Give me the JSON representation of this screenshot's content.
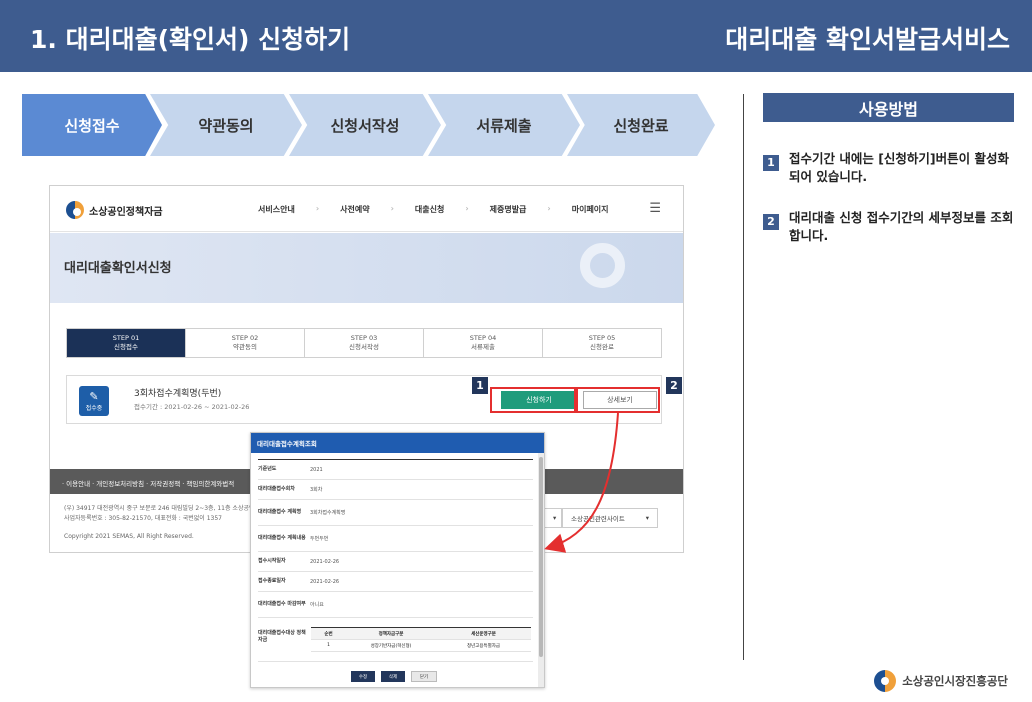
{
  "header": {
    "title": "1. 대리대출(확인서) 신청하기",
    "service": "대리대출 확인서발급서비스"
  },
  "process_steps": [
    {
      "label": "신청접수",
      "active": true
    },
    {
      "label": "약관동의",
      "active": false
    },
    {
      "label": "신청서작성",
      "active": false
    },
    {
      "label": "서류제출",
      "active": false
    },
    {
      "label": "신청완료",
      "active": false
    }
  ],
  "howto": {
    "title": "사용방법",
    "items": [
      {
        "num": "1",
        "text": "접수기간 내에는 [신청하기]버튼이 활성화 되어 있습니다."
      },
      {
        "num": "2",
        "text": "대리대출 신청 접수기간의 세부정보를 조회합니다."
      }
    ]
  },
  "footer_logo": {
    "text": "소상공인시장진흥공단"
  },
  "screenshot": {
    "logo_text": "소상공인정책자금",
    "menu": [
      "서비스안내",
      "사전예약",
      "대출신청",
      "제증명발급",
      "마이페이지"
    ],
    "banner_title": "대리대출확인서신청",
    "steps": [
      {
        "step": "STEP 01",
        "label": "신청접수"
      },
      {
        "step": "STEP 02",
        "label": "약관동의"
      },
      {
        "step": "STEP 03",
        "label": "신청서작성"
      },
      {
        "step": "STEP 04",
        "label": "서류제출"
      },
      {
        "step": "STEP 05",
        "label": "신청완료"
      }
    ],
    "card": {
      "icon_label": "접수중",
      "title": "3회차접수계획명(두번)",
      "period": "접수기간 : 2021-02-26 ~ 2021-02-26",
      "apply_label": "신청하기",
      "detail_label": "상세보기"
    },
    "markers": [
      "1",
      "2"
    ],
    "footer_links": "· 이용안내  · 개인정보처리방침  · 저작권정책  · 책임의한계와법적",
    "footer_info_1": "(우) 34917 대전광역시 중구 보문로 246 대림빌딩 2~3층, 11층 소상공인시",
    "footer_info_2": "사업자등록번호 : 305-82-21570, 대표전화 : 국번없이 1357",
    "copyright": "Copyright 2021 SEMAS, All Right Reserved.",
    "site_select": "소상공인관련사이트"
  },
  "modal": {
    "title": "대리대출접수계획조회",
    "rows": [
      {
        "label": "기준년도",
        "value": "2021"
      },
      {
        "label": "대리대출접수회차",
        "value": "3회차"
      },
      {
        "label": "대리대출접수 계획명",
        "value": "3회차접수계획명"
      },
      {
        "label": "대리대출접수 계획내용",
        "value": "두번두번"
      },
      {
        "label": "접수시작일자",
        "value": "2021-02-26"
      },
      {
        "label": "접수종료일자",
        "value": "2021-02-26"
      },
      {
        "label": "대리대출접수 마감여부",
        "value": "아니요"
      },
      {
        "label": "대리대출접수대상 정책자금",
        "value": ""
      }
    ],
    "table_headers": [
      "순번",
      "정책자금구분",
      "세산운영구분"
    ],
    "table_row": [
      "1",
      "성장기반자금(혁신형)",
      "청년고용특별자금"
    ],
    "buttons": [
      "수정",
      "삭제",
      "닫기"
    ]
  }
}
